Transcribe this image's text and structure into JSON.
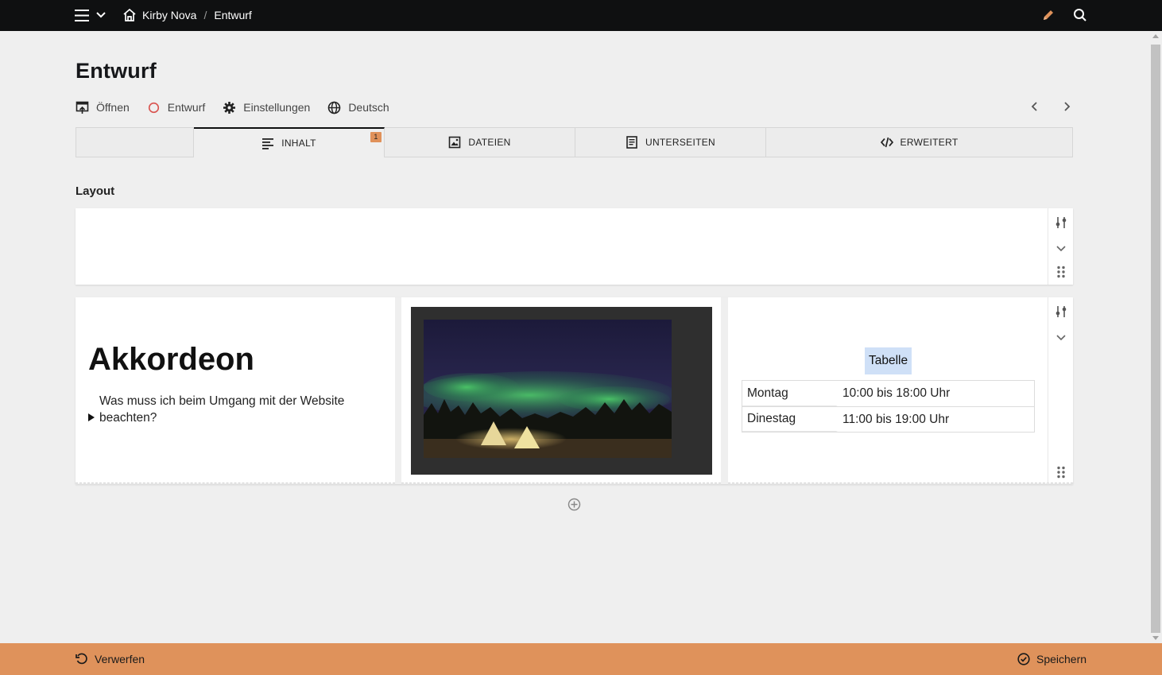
{
  "topbar": {
    "breadcrumbs": [
      "Kirby Nova",
      "Entwurf"
    ],
    "separator": "/",
    "icons": [
      "menu-icon",
      "chevron-down-icon",
      "home-icon",
      "pencil-icon",
      "search-icon"
    ]
  },
  "page": {
    "title": "Entwurf",
    "actions": {
      "open": "Öffnen",
      "status": "Entwurf",
      "settings": "Einstellungen",
      "language": "Deutsch"
    }
  },
  "tabs": [
    {
      "label": "INHALT",
      "icon": "text-lines-icon",
      "badge": "1",
      "active": true
    },
    {
      "label": "DATEIEN",
      "icon": "image-icon"
    },
    {
      "label": "UNTERSEITEN",
      "icon": "page-icon"
    },
    {
      "label": "ERWEITERT",
      "icon": "code-icon"
    }
  ],
  "content": {
    "section_label": "Layout",
    "accordion": {
      "title": "Akkordeon",
      "item": "Was muss ich beim Umgang mit der Website beachten?"
    },
    "table": {
      "caption": "Tabelle",
      "rows": [
        [
          "Montag",
          "10:00 bis 18:00 Uhr"
        ],
        [
          "Dinestag",
          "11:00 bis 19:00 Uhr"
        ]
      ]
    }
  },
  "bottombar": {
    "discard": "Verwerfen",
    "save": "Speichern"
  },
  "colors": {
    "topbar": "#0f1011",
    "accent": "#df925b",
    "status_draft": "#d9534f",
    "caption_highlight": "#cfe0f7"
  }
}
